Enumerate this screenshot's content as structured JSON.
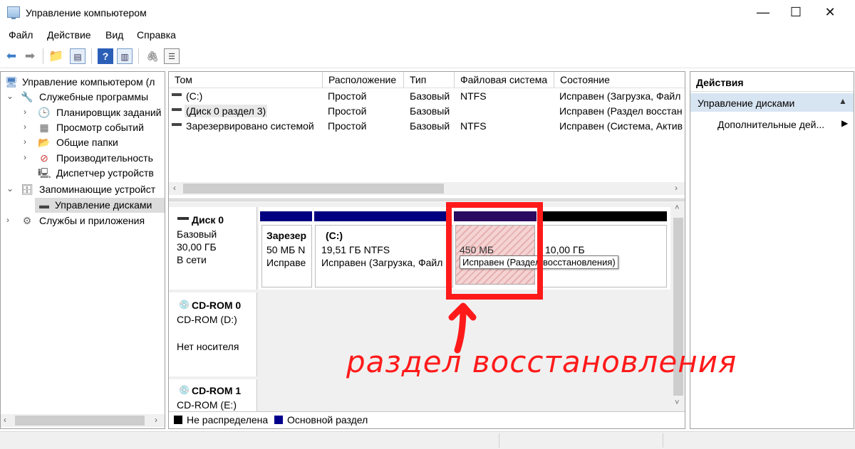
{
  "window": {
    "title": "Управление компьютером",
    "minimize": "—",
    "maximize": "☐",
    "close": "✕"
  },
  "menu": [
    "Файл",
    "Действие",
    "Вид",
    "Справка"
  ],
  "tree": [
    {
      "label": "Управление компьютером (л"
    },
    {
      "label": "Служебные программы"
    },
    {
      "label": "Планировщик заданий"
    },
    {
      "label": "Просмотр событий"
    },
    {
      "label": "Общие папки"
    },
    {
      "label": "Производительность"
    },
    {
      "label": "Диспетчер устройств"
    },
    {
      "label": "Запоминающие устройст"
    },
    {
      "label": "Управление дисками"
    },
    {
      "label": "Службы и приложения"
    }
  ],
  "volumes": {
    "headers": [
      "Том",
      "Расположение",
      "Тип",
      "Файловая система",
      "Состояние"
    ],
    "rows": [
      [
        "(C:)",
        "Простой",
        "Базовый",
        "NTFS",
        "Исправен (Загрузка, Файл"
      ],
      [
        "(Диск 0 раздел 3)",
        "Простой",
        "Базовый",
        "",
        "Исправен (Раздел восстан"
      ],
      [
        "Зарезервировано системой",
        "Простой",
        "Базовый",
        "NTFS",
        "Исправен (Система, Актив"
      ]
    ]
  },
  "disks": [
    {
      "name": "Диск 0",
      "line1": "Базовый",
      "line2": "30,00 ГБ",
      "line3": "В сети"
    },
    {
      "name": "CD-ROM 0",
      "line1": "CD-ROM (D:)",
      "line2": "",
      "line3": "Нет носителя"
    },
    {
      "name": "CD-ROM 1",
      "line1": "CD-ROM (E:)"
    }
  ],
  "partitions": [
    {
      "title": "Зарезер",
      "size": "50 МБ N",
      "status": "Исправе"
    },
    {
      "title": "(C:)",
      "size": "19,51 ГБ NTFS",
      "status": "Исправен (Загрузка, Файл"
    },
    {
      "title": "",
      "size": "450 МБ",
      "status": ""
    },
    {
      "title": "",
      "size": "10,00 ГБ",
      "status": ""
    }
  ],
  "tooltip": "Исправен (Раздел восстановления)",
  "legend": [
    {
      "label": "Не распределена",
      "color": "#000000"
    },
    {
      "label": "Основной раздел",
      "color": "#00008b"
    }
  ],
  "actions": {
    "title": "Действия",
    "section": "Управление дисками",
    "more": "Дополнительные дей..."
  },
  "annotation": {
    "text": "раздел восстановления",
    "color": "#ff1a1a"
  }
}
